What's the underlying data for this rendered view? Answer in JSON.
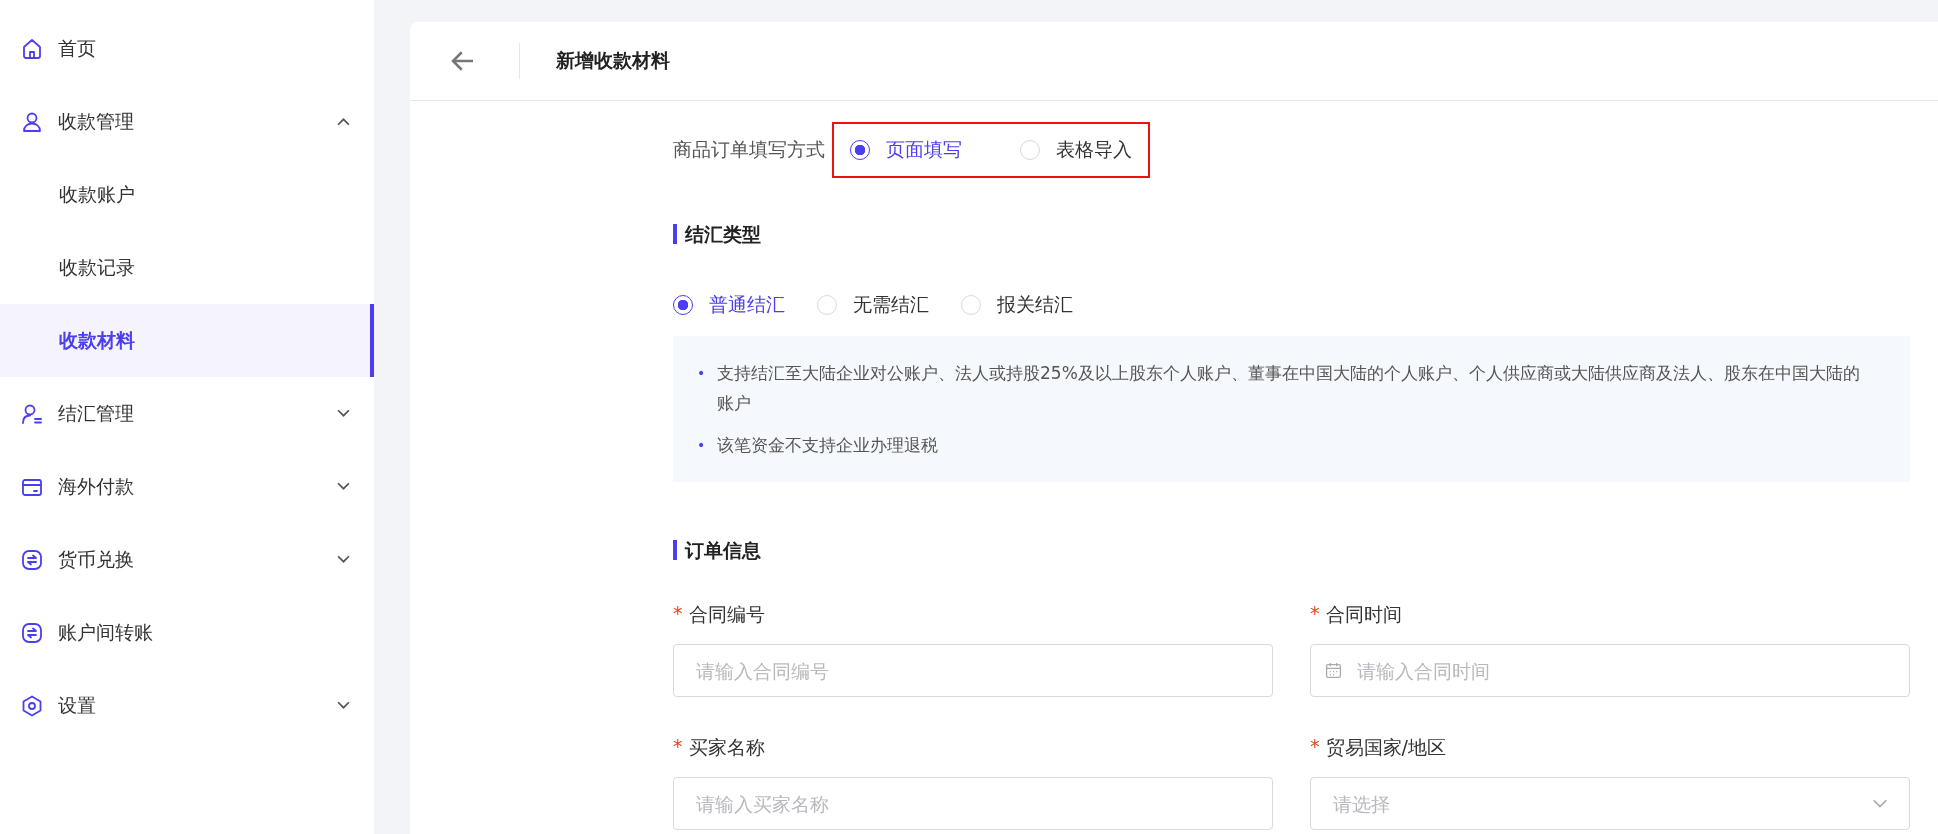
{
  "sidebar": {
    "items": [
      {
        "label": "首页",
        "kind": "home",
        "selected": false
      },
      {
        "label": "收款管理",
        "kind": "user",
        "selected": false,
        "expanded": true,
        "children": [
          {
            "label": "收款账户",
            "selected": false
          },
          {
            "label": "收款记录",
            "selected": false
          },
          {
            "label": "收款材料",
            "selected": true
          }
        ]
      },
      {
        "label": "结汇管理",
        "kind": "user-list",
        "selected": false,
        "expanded": false
      },
      {
        "label": "海外付款",
        "kind": "card",
        "selected": false,
        "expanded": false
      },
      {
        "label": "货币兑换",
        "kind": "exchange",
        "selected": false,
        "expanded": false
      },
      {
        "label": "账户间转账",
        "kind": "exchange",
        "selected": false
      },
      {
        "label": "设置",
        "kind": "settings",
        "selected": false,
        "expanded": false
      }
    ]
  },
  "header": {
    "title": "新增收款材料"
  },
  "order_mode": {
    "label": "商品订单填写方式",
    "highlighted": true,
    "options": [
      {
        "label": "页面填写",
        "selected": true
      },
      {
        "label": "表格导入",
        "selected": false
      }
    ]
  },
  "sections": [
    {
      "title": "结汇类型",
      "kind": "radios",
      "options": [
        {
          "label": "普通结汇",
          "selected": true
        },
        {
          "label": "无需结汇",
          "selected": false
        },
        {
          "label": "报关结汇",
          "selected": false
        }
      ],
      "notes": [
        {
          "bullet": "•",
          "text": "支持结汇至大陆企业对公账户、法人或持股25%及以上股东个人账户、董事在中国大陆的个人账户、个人供应商或大陆供应商及法人、股东在中国大陆的账户"
        },
        {
          "bullet": "•",
          "text": "该笔资金不支持企业办理退税"
        }
      ]
    },
    {
      "title": "订单信息",
      "kind": "fields",
      "fields": [
        {
          "label": "合同编号",
          "required_mark": "*",
          "kind": "text",
          "placeholder": "请输入合同编号"
        },
        {
          "label": "合同时间",
          "required_mark": "*",
          "kind": "date",
          "placeholder": "请输入合同时间"
        },
        {
          "label": "买家名称",
          "required_mark": "*",
          "kind": "text",
          "placeholder": "请输入买家名称"
        },
        {
          "label": "贸易国家/地区",
          "required_mark": "*",
          "kind": "select",
          "placeholder": "请选择"
        }
      ]
    }
  ]
}
